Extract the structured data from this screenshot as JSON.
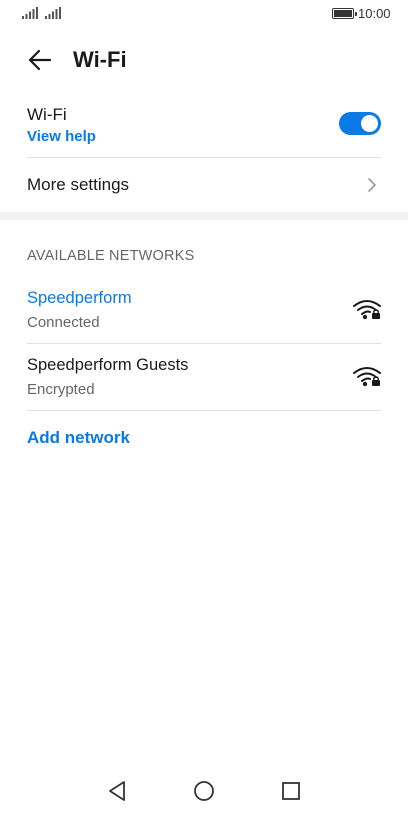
{
  "status_bar": {
    "time": "10:00",
    "icons": [
      "signal-icon",
      "signal-icon",
      "battery-icon"
    ]
  },
  "header": {
    "back_icon": "back-arrow-icon",
    "title": "Wi-Fi"
  },
  "wifi_toggle": {
    "label": "Wi-Fi",
    "help_link": "View help",
    "enabled": true,
    "accent_color": "#0a7ae6"
  },
  "more_settings": {
    "label": "More settings",
    "icon": "chevron-right-icon"
  },
  "available_networks": {
    "header": "AVAILABLE NETWORKS",
    "networks": [
      {
        "name": "Speedperform",
        "status": "Connected",
        "active": true,
        "icon": "wifi-locked-icon"
      },
      {
        "name": "Speedperform Guests",
        "status": "Encrypted",
        "active": false,
        "icon": "wifi-locked-icon"
      }
    ],
    "add_network_label": "Add network"
  },
  "nav_bar": {
    "buttons": [
      "back-triangle-icon",
      "home-circle-icon",
      "recents-square-icon"
    ]
  }
}
